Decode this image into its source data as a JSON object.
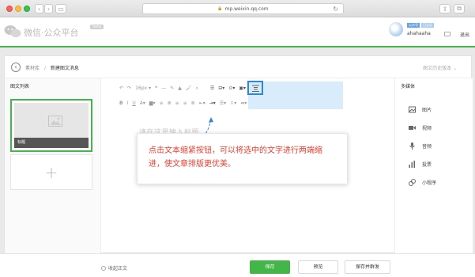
{
  "browser": {
    "url": "mp.weixin.qq.com"
  },
  "app": {
    "brand": "微信·公众平台",
    "brand_badge": "beta",
    "user_tags": [
      "公众号",
      "已认证"
    ],
    "username": "ahahaaha",
    "logout_label": "退出"
  },
  "breadcrumb": {
    "parent": "素材库",
    "separator": "/",
    "current": "新建图文消息"
  },
  "history_label": "图文历史版本 ⌄",
  "left_panel": {
    "title": "图文列表",
    "article_caption": "标题",
    "add_symbol": "+"
  },
  "toolbar": {
    "row1": [
      "↶",
      "↷",
      "16px ▾",
      "❝",
      "—",
      "✎",
      "▲",
      "🖌",
      "⌕",
      "☰",
      "⊟▾",
      "⊙▾",
      "▣▾",
      "▦",
      "▤"
    ],
    "row2": [
      "B",
      "I",
      "U",
      "A▾",
      "▆▾",
      "≡",
      "≣",
      "≡",
      "≡",
      "≣",
      "⇤▾",
      "⇥▾",
      "☰▾",
      "⇳▾",
      "⇼▾"
    ]
  },
  "editor": {
    "title_placeholder": "请在这里输入标题"
  },
  "tooltip": {
    "text": "点击文本缩紧按钮，可以将选中的文字进行两端缩进，使文章排版更优美。"
  },
  "right_panel": {
    "title": "多媒体",
    "items": [
      {
        "label": "图片",
        "icon": "image-icon"
      },
      {
        "label": "视频",
        "icon": "video-icon"
      },
      {
        "label": "音频",
        "icon": "audio-icon"
      },
      {
        "label": "投票",
        "icon": "vote-icon"
      },
      {
        "label": "小程序",
        "icon": "miniprogram-icon"
      }
    ]
  },
  "bottom": {
    "collapse_label": "收起正文",
    "save_label": "保存",
    "preview_label": "预览",
    "publish_label": "保存并群发"
  },
  "colors": {
    "accent": "#44b549",
    "tooltip_text": "#e83e2e",
    "toolbar_highlight": "#d9ecfb",
    "focus_border": "#2e86de"
  }
}
